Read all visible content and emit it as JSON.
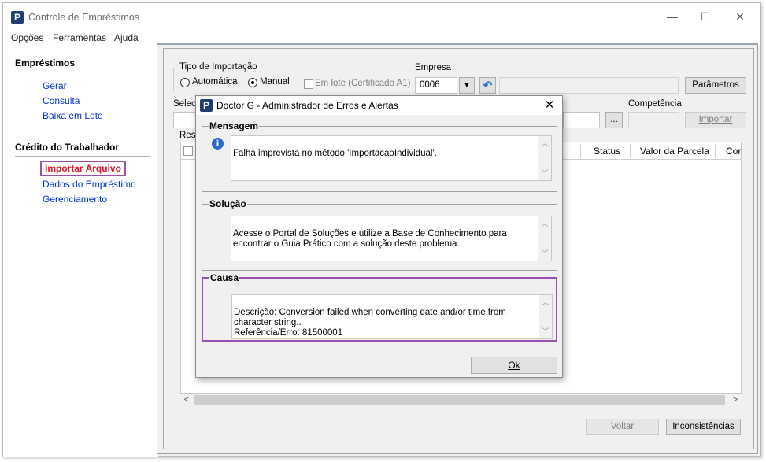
{
  "window": {
    "title": "Controle de Empréstimos",
    "icon_letter": "P",
    "controls": {
      "minimize": "—",
      "maximize": "☐",
      "close": "✕"
    }
  },
  "menu": [
    "Opções",
    "Ferramentas",
    "Ajuda"
  ],
  "sidebar": {
    "sections": [
      {
        "header": "Empréstimos",
        "items": [
          "Gerar",
          "Consulta",
          "Baixa em Lote"
        ]
      },
      {
        "header": "Crédito do Trabalhador",
        "items": [
          "Importar Arquivo",
          "Dados do Empréstimo",
          "Gerenciamento"
        ]
      }
    ],
    "active_item": "Importar Arquivo"
  },
  "form": {
    "tipo_importacao": {
      "legend": "Tipo de Importação",
      "options": [
        "Automática",
        "Manual"
      ],
      "selected": "Manual"
    },
    "em_lote_label": "Em lote (Certificado A1)",
    "empresa_label": "Empresa",
    "empresa_value": "0006",
    "parametros_label": "Parâmetros",
    "selecionar_label": "Selec",
    "browse_label": "...",
    "competencia_label": "Competência",
    "importar_label": "Importar",
    "result_label": "Resu",
    "grid_columns": [
      "Status",
      "Valor da Parcela",
      "Cor"
    ],
    "voltar_label": "Voltar",
    "inconsistencias_label": "Inconsistências"
  },
  "dialog": {
    "title": "Doctor G - Administrador de Erros e Alertas",
    "icon_letter": "P",
    "close": "✕",
    "mensagem": {
      "legend": "Mensagem",
      "text": "Falha imprevista no método 'ImportacaoIndividual'."
    },
    "solucao": {
      "legend": "Solução",
      "text": "Acesse o Portal de Soluções e utilize a Base de Conhecimento para encontrar o Guia Prático com a solução deste problema."
    },
    "causa": {
      "legend": "Causa",
      "text": "Descrição: Conversion failed when converting date and/or time from character string..\nReferência/Erro: 81500001"
    },
    "ok_label": "Ok",
    "colors": {
      "highlight": "#9b4fb0",
      "info": "#2b6cc9"
    }
  }
}
